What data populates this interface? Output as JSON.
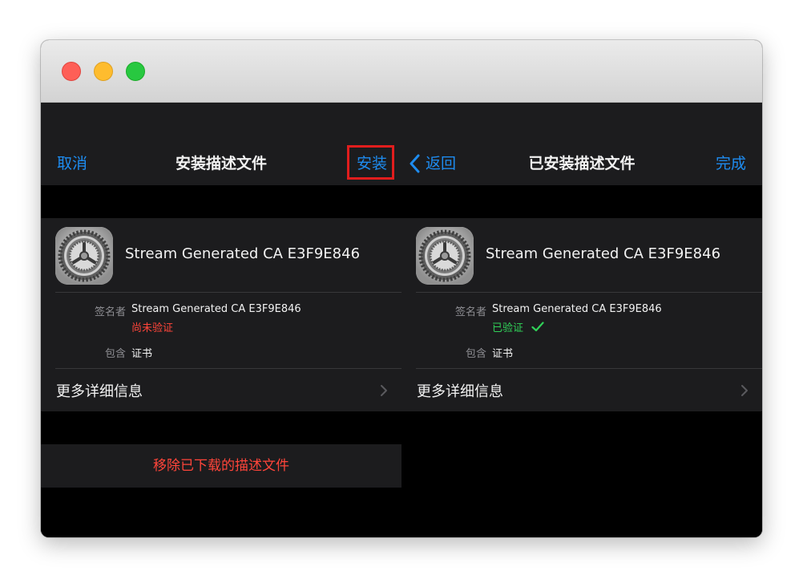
{
  "window": {
    "buttons": [
      "close",
      "minimize",
      "maximize"
    ]
  },
  "left_pane": {
    "nav": {
      "cancel_label": "取消",
      "title": "安装描述文件",
      "install_label": "安装"
    },
    "profile": {
      "icon": "settings-gear-icon",
      "name": "Stream Generated CA E3F9E846",
      "signer_label": "签名者",
      "signer_value": "Stream Generated CA E3F9E846",
      "verification_status": "尚未验证",
      "contains_label": "包含",
      "contains_value": "证书"
    },
    "more_details_label": "更多详细信息",
    "remove_label": "移除已下载的描述文件"
  },
  "right_pane": {
    "nav": {
      "back_label": "返回",
      "title": "已安装描述文件",
      "done_label": "完成"
    },
    "profile": {
      "icon": "settings-gear-icon",
      "name": "Stream Generated CA E3F9E846",
      "signer_label": "签名者",
      "signer_value": "Stream Generated CA E3F9E846",
      "verification_status": "已验证",
      "contains_label": "包含",
      "contains_value": "证书"
    },
    "more_details_label": "更多详细信息"
  },
  "colors": {
    "accent_blue": "#1e8cf0",
    "destructive_red": "#ff453a",
    "success_green": "#30d158",
    "highlight_box": "#e11d1d"
  }
}
